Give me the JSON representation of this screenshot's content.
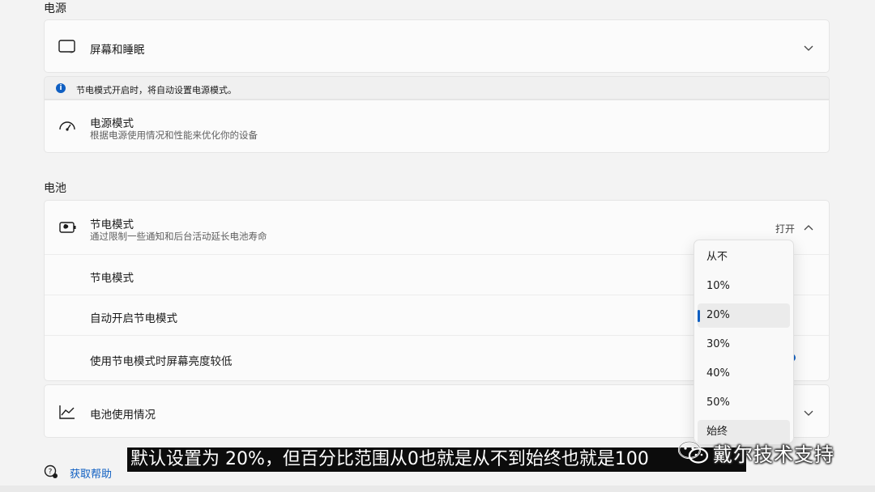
{
  "power": {
    "section_label": "电源",
    "screen_sleep_label": "屏幕和睡眠",
    "info_text": "节电模式开启时，将自动设置电源模式。",
    "power_mode_title": "电源模式",
    "power_mode_subtitle": "根据电源使用情况和性能来优化你的设备"
  },
  "battery": {
    "section_label": "电池",
    "saver_title": "节电模式",
    "saver_subtitle": "通过限制一些通知和后台活动延长电池寿命",
    "saver_status": "打开",
    "sub_saver_label": "节电模式",
    "auto_on_label": "自动开启节电模式",
    "dim_label": "使用节电模式时屏幕亮度较低",
    "usage_label": "电池使用情况"
  },
  "dropdown": {
    "options": [
      "从不",
      "10%",
      "20%",
      "30%",
      "40%",
      "50%",
      "始终"
    ],
    "selected_index": 2,
    "selected_value": "20%"
  },
  "help": {
    "link_label": "获取帮助"
  },
  "overlay": {
    "caption": "默认设置为 20%，但百分比范围从0也就是从不到始终也就是100",
    "watermark": "戴尔技术支持"
  },
  "colors": {
    "accent": "#0f5fc2",
    "background": "#f3f3f3",
    "card": "#fbfbfb"
  }
}
